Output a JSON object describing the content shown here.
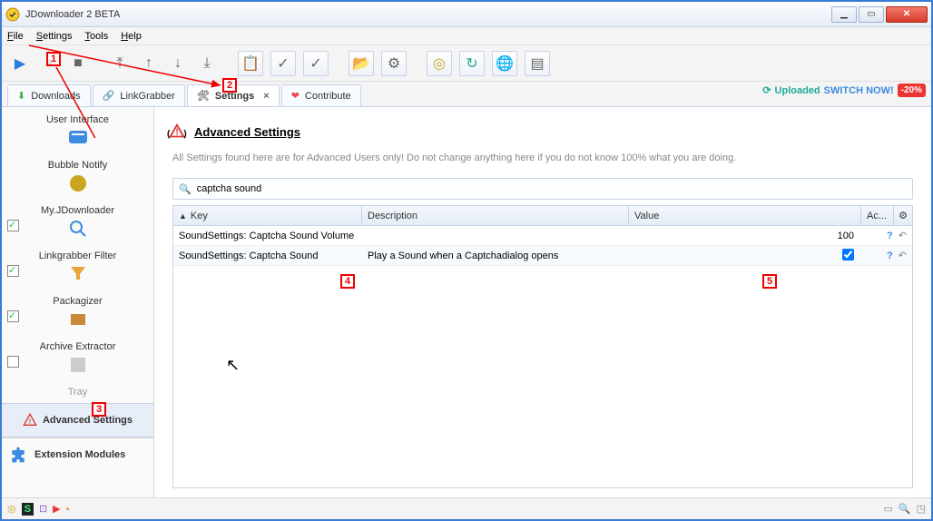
{
  "window": {
    "title": "JDownloader 2 BETA"
  },
  "menu": {
    "file": "File",
    "settings": "Settings",
    "tools": "Tools",
    "help": "Help"
  },
  "tabs": {
    "downloads": "Downloads",
    "linkgrabber": "LinkGrabber",
    "settings": "Settings",
    "contribute": "Contribute"
  },
  "promo": {
    "brand1": "Uploaded",
    "brand2": "SWITCH NOW!",
    "badge": "-20%"
  },
  "sidebar": {
    "items": [
      {
        "label": "User Interface"
      },
      {
        "label": "Bubble Notify"
      },
      {
        "label": "My.JDownloader"
      },
      {
        "label": "Linkgrabber Filter"
      },
      {
        "label": "Packagizer"
      },
      {
        "label": "Archive Extractor"
      },
      {
        "label": "Tray"
      }
    ],
    "advanced": "Advanced Settings",
    "extension": "Extension Modules"
  },
  "main": {
    "heading": "Advanced Settings",
    "note": "All Settings found here are for Advanced Users only! Do not change anything here if you do not know 100% what you are doing.",
    "search_value": "captcha sound"
  },
  "table": {
    "cols": {
      "key": "Key",
      "desc": "Description",
      "value": "Value",
      "ac": "Ac..."
    },
    "rows": [
      {
        "key": "SoundSettings: Captcha Sound Volume",
        "desc": "",
        "value": "100",
        "checkbox": false
      },
      {
        "key": "SoundSettings: Captcha Sound",
        "desc": "Play a Sound when a Captchadialog opens",
        "value": "",
        "checkbox": true
      }
    ]
  },
  "markers": {
    "m1": "1",
    "m2": "2",
    "m3": "3",
    "m4": "4",
    "m5": "5"
  }
}
